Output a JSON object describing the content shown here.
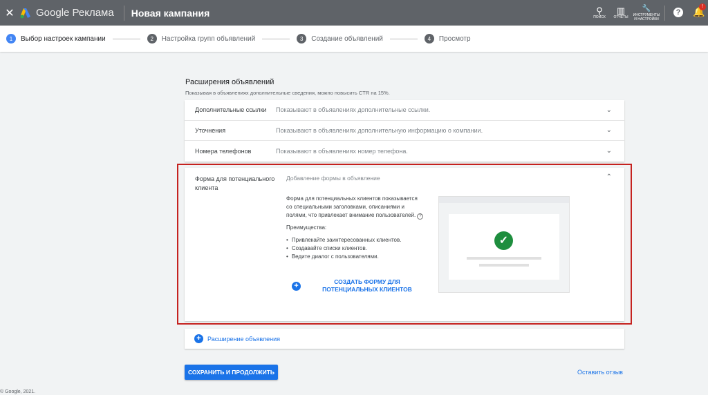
{
  "header": {
    "close": "✕",
    "brand": "Google Реклама",
    "title": "Новая кампания",
    "actions": [
      {
        "icon": "search-icon",
        "glyph": "⚲",
        "label": "ПОИСК"
      },
      {
        "icon": "reports-icon",
        "glyph": "▥",
        "label": "ОТЧЕТЫ"
      },
      {
        "icon": "tools-icon",
        "glyph": "🔧",
        "label": "ИНСТРУМЕНТЫ И НАСТРОЙКИ"
      }
    ],
    "help": "?",
    "notif_badge": "!"
  },
  "stepper": [
    {
      "num": "1",
      "label": "Выбор настроек кампании",
      "active": true
    },
    {
      "num": "2",
      "label": "Настройка групп объявлений"
    },
    {
      "num": "3",
      "label": "Создание объявлений"
    },
    {
      "num": "4",
      "label": "Просмотр"
    }
  ],
  "section": {
    "title": "Расширения объявлений",
    "subtitle": "Показывая в объявлениях дополнительные сведения, можно повысить CTR на 15%.",
    "rows": [
      {
        "name": "Дополнительные ссылки",
        "desc": "Показывают в объявлениях дополнительные ссылки."
      },
      {
        "name": "Уточнения",
        "desc": "Показывают в объявлениях дополнительную информацию о компании."
      },
      {
        "name": "Номера телефонов",
        "desc": "Показывают в объявлениях номер телефона."
      }
    ],
    "expanded": {
      "name": "Форма для потенциального клиента",
      "desc": "Добавление формы в объявление",
      "body": "Форма для потенциальных клиентов показывается со специальными заголовками, описаниями и полями, что привлекает внимание пользователей.",
      "help": "?",
      "benefits_title": "Преимущества:",
      "benefits": [
        "Привлекайте заинтересованных клиентов.",
        "Создавайте списки клиентов.",
        "Ведите диалог с пользователями."
      ],
      "cta": "СОЗДАТЬ ФОРМУ ДЛЯ ПОТЕНЦИАЛЬНЫХ КЛИЕНТОВ"
    },
    "add": "Расширение объявления"
  },
  "save": "СОХРАНИТЬ И ПРОДОЛЖИТЬ",
  "feedback": "Оставить отзыв",
  "footer": "© Google, 2021.",
  "colors": {
    "accent": "#1a73e8",
    "highlight": "#c5221f",
    "header": "#5f6368"
  }
}
